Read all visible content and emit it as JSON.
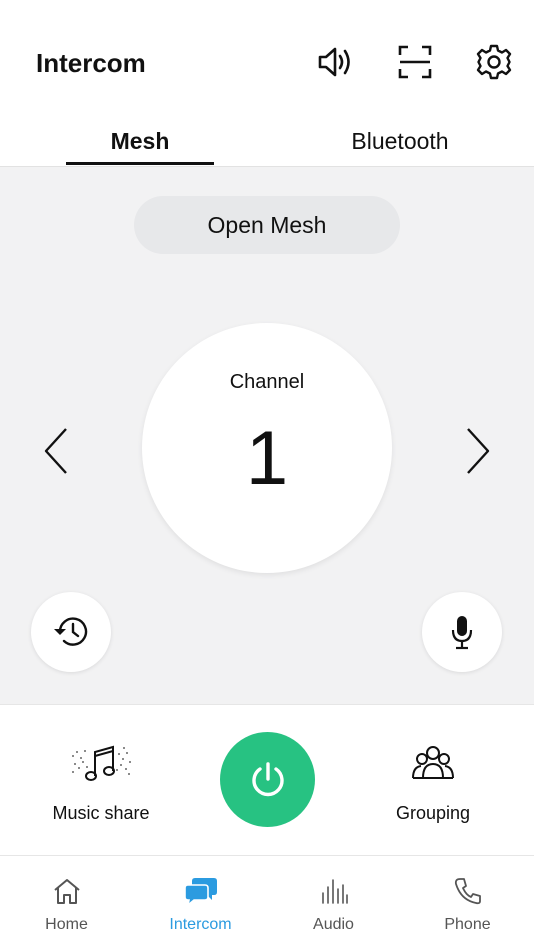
{
  "header": {
    "title": "Intercom",
    "icons": [
      "speaker-volume-icon",
      "scan-icon",
      "gear-icon"
    ]
  },
  "tabs": [
    {
      "label": "Mesh",
      "active": true
    },
    {
      "label": "Bluetooth",
      "active": false
    }
  ],
  "mesh": {
    "pill_label": "Open Mesh",
    "channel_label": "Channel",
    "channel_number": "1"
  },
  "actions": {
    "music_share": "Music share",
    "grouping": "Grouping"
  },
  "nav": [
    {
      "label": "Home",
      "icon": "home-icon",
      "active": false
    },
    {
      "label": "Intercom",
      "icon": "chat-bubbles-icon",
      "active": true
    },
    {
      "label": "Audio",
      "icon": "equalizer-icon",
      "active": false
    },
    {
      "label": "Phone",
      "icon": "phone-icon",
      "active": false
    }
  ],
  "colors": {
    "accent": "#2b9be0",
    "power": "#27c282",
    "panel": "#f2f2f3"
  }
}
